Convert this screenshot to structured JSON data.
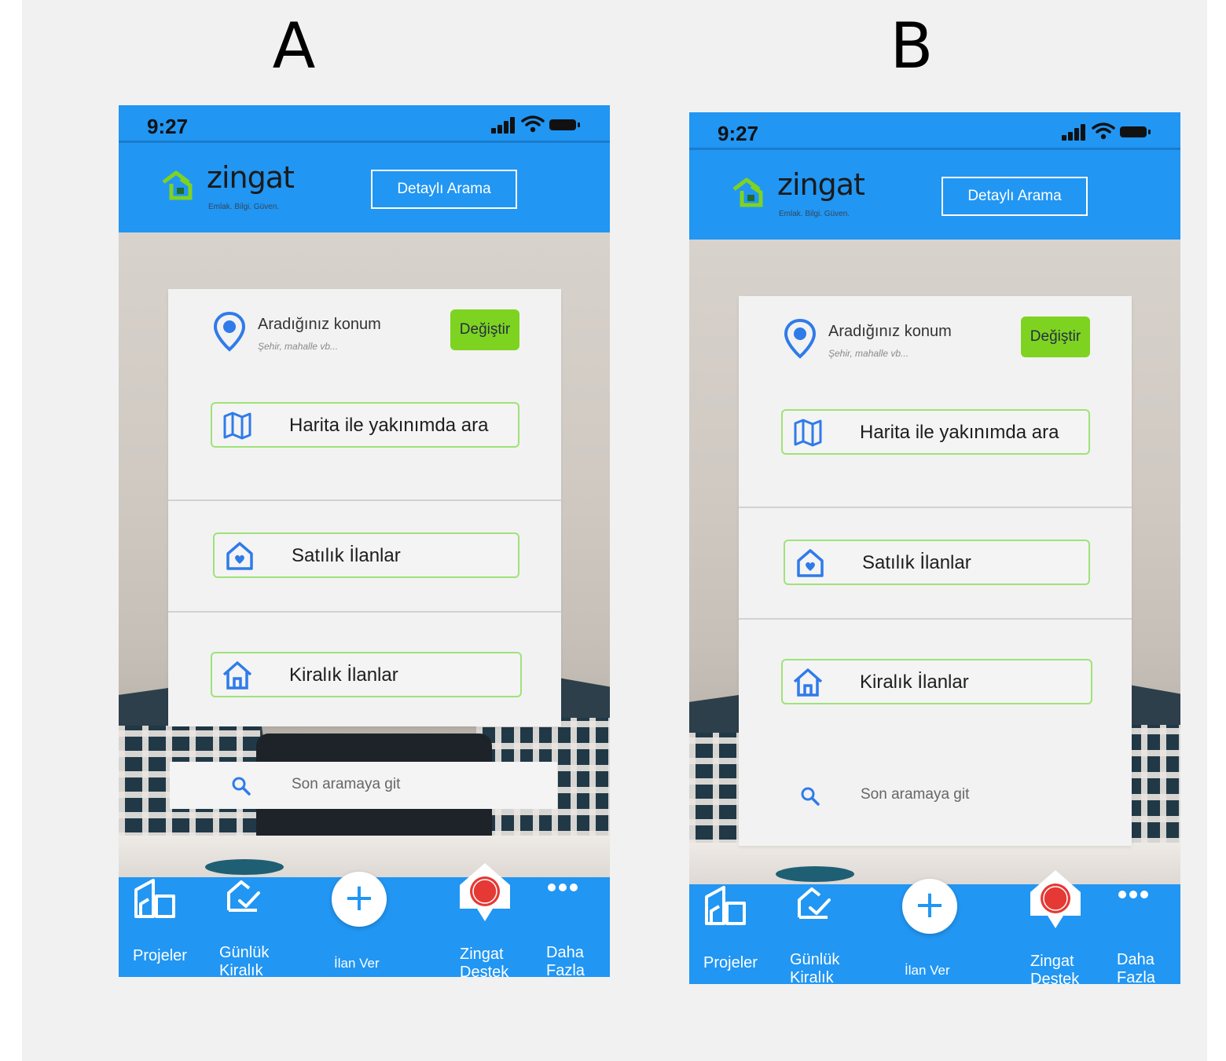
{
  "labels": [
    "A",
    "B"
  ],
  "phone": {
    "time": "9:27",
    "logo": {
      "name": "zingat",
      "tagline": "Emlak. Bilgi. Güven."
    },
    "detail_search": "Detaylı Arama",
    "location": {
      "title": "Aradığınız konum",
      "placeholder": "Şehir, mahalle vb...",
      "change": "Değiştir"
    },
    "options": [
      "Harita ile yakınımda ara",
      "Satılık İlanlar",
      "Kiralık İlanlar"
    ],
    "recent_search": "Son aramaya git",
    "nav": {
      "projects": "Projeler",
      "daily_rent_1": "Günlük",
      "daily_rent_2": "Kiralık",
      "post_ad": "İlan Ver",
      "support_1": "Zingat",
      "support_2": "Destek",
      "more_1": "Daha",
      "more_2": "Fazla"
    }
  },
  "colors": {
    "brand_blue": "#2196f3",
    "accent_green": "#7ed321",
    "logo_green": "#7ed321",
    "icon_blue": "#2f7bea"
  }
}
